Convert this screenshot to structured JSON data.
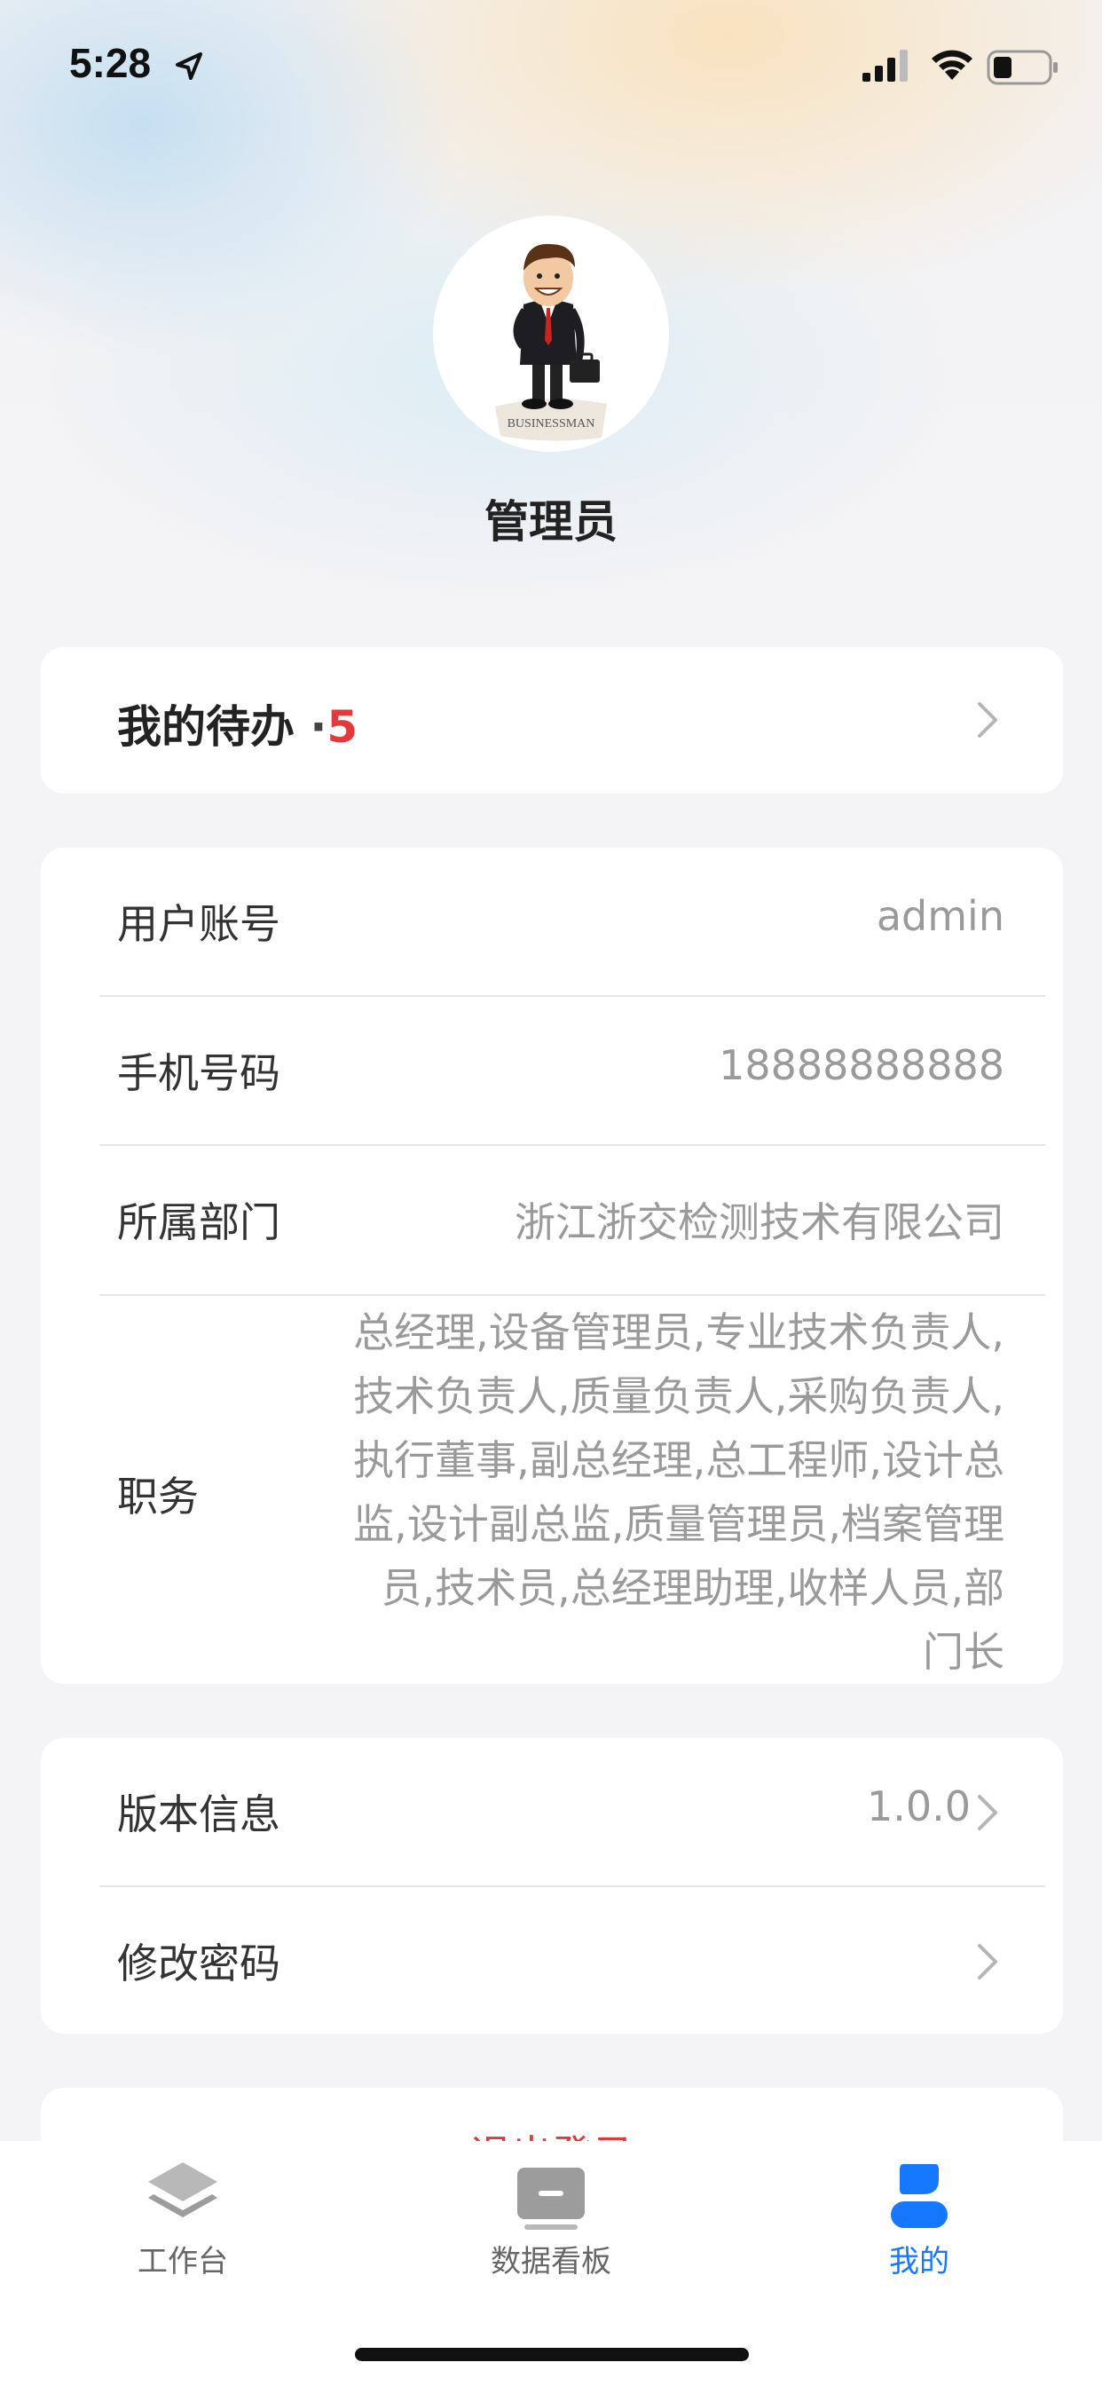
{
  "status_bar": {
    "time": "5:28"
  },
  "profile": {
    "name": "管理员",
    "avatar_caption": "BUSINESSMAN"
  },
  "todo": {
    "label": "我的待办",
    "separator": "·",
    "count": "5"
  },
  "info": {
    "account": {
      "label": "用户账号",
      "value": "admin"
    },
    "phone": {
      "label": "手机号码",
      "value": "18888888888"
    },
    "department": {
      "label": "所属部门",
      "value": "浙江浙交检测技术有限公司"
    },
    "position": {
      "label": "职务",
      "value": "总经理,设备管理员,专业技术负责人,技术负责人,质量负责人,采购负责人,执行董事,副总经理,总工程师,设计总监,设计副总监,质量管理员,档案管理员,技术员,总经理助理,收样人员,部门长"
    }
  },
  "settings": {
    "version": {
      "label": "版本信息",
      "value": "1.0.0"
    },
    "password": {
      "label": "修改密码"
    }
  },
  "logout": {
    "label": "退出登录"
  },
  "tabs": [
    {
      "label": "工作台",
      "icon": "layers-icon",
      "active": false
    },
    {
      "label": "数据看板",
      "icon": "dashboard-icon",
      "active": false
    },
    {
      "label": "我的",
      "icon": "user-icon",
      "active": true
    }
  ],
  "colors": {
    "accent": "#1677ff",
    "badge": "#e23a3a",
    "muted": "#9a9a9a"
  }
}
